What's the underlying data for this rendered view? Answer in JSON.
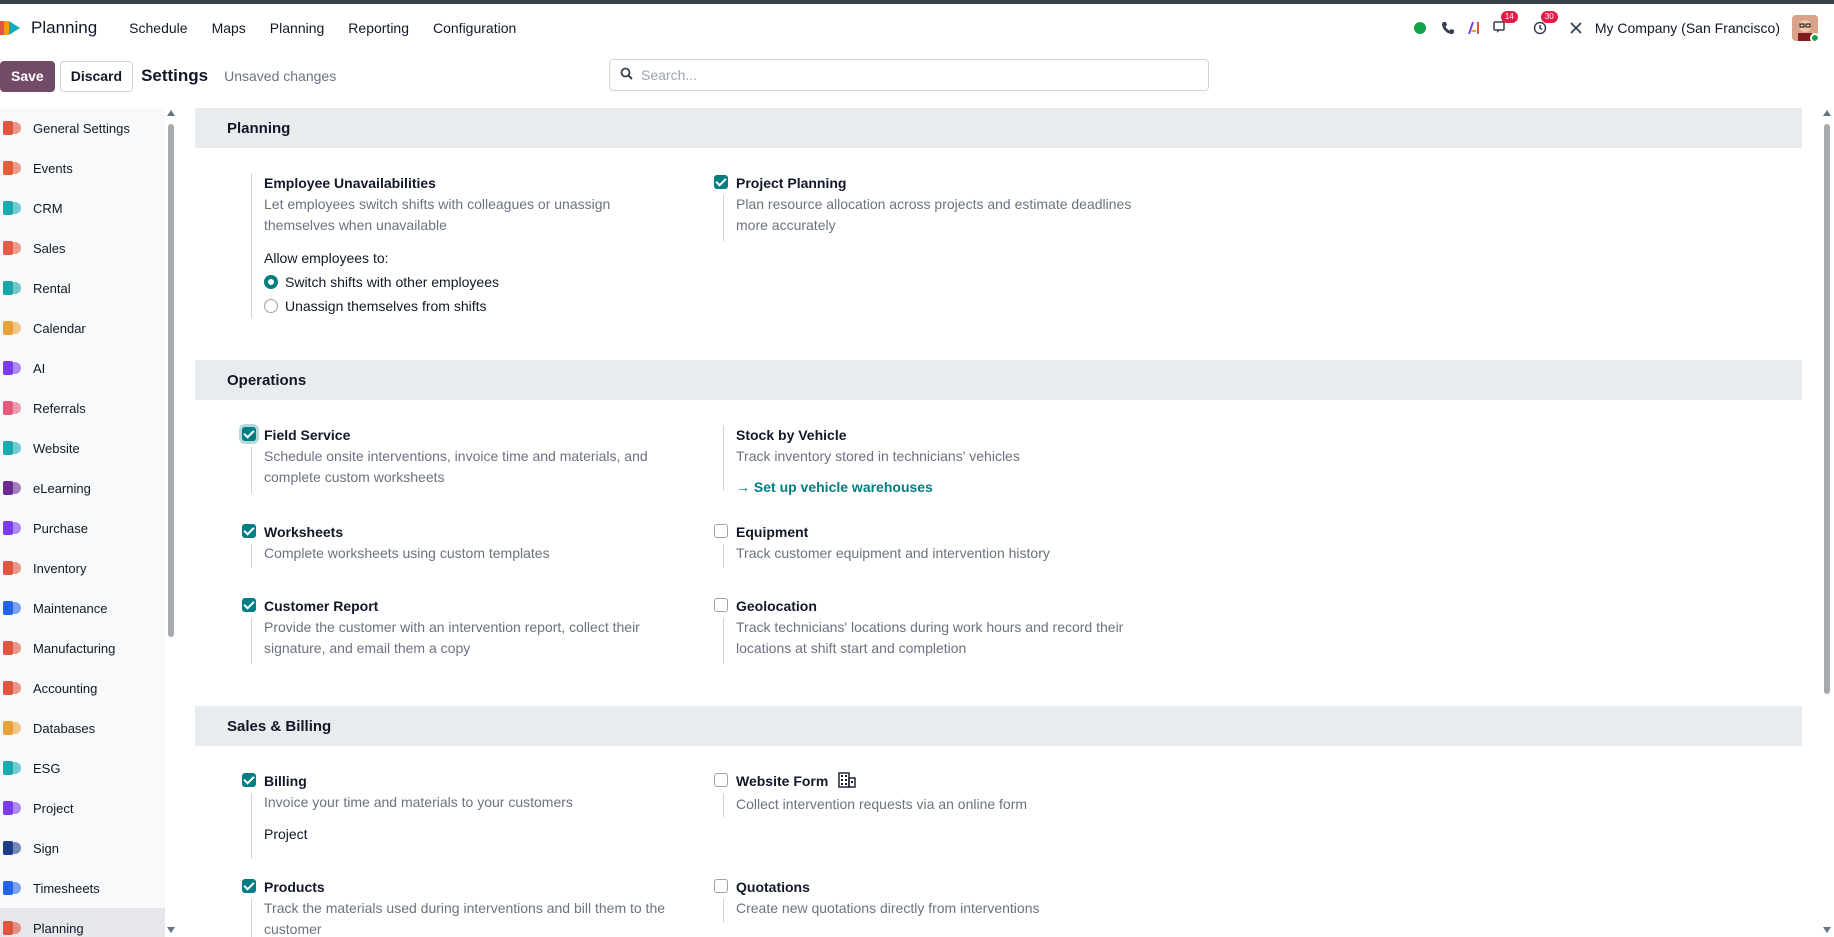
{
  "app": {
    "name": "Planning",
    "menu": [
      "Schedule",
      "Maps",
      "Planning",
      "Reporting",
      "Configuration"
    ],
    "company": "My Company (San Francisco)",
    "badges": {
      "discuss": "14",
      "activities": "30"
    }
  },
  "control": {
    "save_label": "Save",
    "discard_label": "Discard",
    "title": "Settings",
    "status": "Unsaved changes",
    "search_placeholder": "Search..."
  },
  "sidebar": {
    "items": [
      {
        "label": "General Settings",
        "icon": "general-settings-icon",
        "color": "#e0553f"
      },
      {
        "label": "Events",
        "icon": "events-icon",
        "color": "#e35d3a"
      },
      {
        "label": "CRM",
        "icon": "crm-icon",
        "color": "#19a9b0"
      },
      {
        "label": "Sales",
        "icon": "sales-icon",
        "color": "#e45b45"
      },
      {
        "label": "Rental",
        "icon": "rental-icon",
        "color": "#1aa5a8"
      },
      {
        "label": "Calendar",
        "icon": "calendar-icon",
        "color": "#e9a03b"
      },
      {
        "label": "AI",
        "icon": "ai-icon",
        "color": "#7c3aed"
      },
      {
        "label": "Referrals",
        "icon": "referrals-icon",
        "color": "#e45b7b"
      },
      {
        "label": "Website",
        "icon": "website-icon",
        "color": "#19a9b0"
      },
      {
        "label": "eLearning",
        "icon": "elearning-icon",
        "color": "#6b2c91"
      },
      {
        "label": "Purchase",
        "icon": "purchase-icon",
        "color": "#7c3aed"
      },
      {
        "label": "Inventory",
        "icon": "inventory-icon",
        "color": "#e0553f"
      },
      {
        "label": "Maintenance",
        "icon": "maintenance-icon",
        "color": "#2563eb"
      },
      {
        "label": "Manufacturing",
        "icon": "manufacturing-icon",
        "color": "#e0553f"
      },
      {
        "label": "Accounting",
        "icon": "accounting-icon",
        "color": "#e0553f"
      },
      {
        "label": "Databases",
        "icon": "databases-icon",
        "color": "#e9a03b"
      },
      {
        "label": "ESG",
        "icon": "esg-icon",
        "color": "#19a9b0"
      },
      {
        "label": "Project",
        "icon": "project-icon",
        "color": "#7c3aed"
      },
      {
        "label": "Sign",
        "icon": "sign-icon",
        "color": "#1e3a8a"
      },
      {
        "label": "Timesheets",
        "icon": "timesheets-icon",
        "color": "#2563eb"
      },
      {
        "label": "Planning",
        "icon": "planning-icon",
        "color": "#e0553f"
      }
    ]
  },
  "sections": {
    "planning": {
      "title": "Planning",
      "unavail_title": "Employee Unavailabilities",
      "unavail_desc": "Let employees switch shifts with colleagues or unassign themselves when unavailable",
      "allow_label": "Allow employees to:",
      "radio_switch": "Switch shifts with other employees",
      "radio_unassign": "Unassign themselves from shifts",
      "project_title": "Project Planning",
      "project_desc": "Plan resource allocation across projects and estimate deadlines more accurately"
    },
    "operations": {
      "title": "Operations",
      "field_service_title": "Field Service",
      "field_service_desc": "Schedule onsite interventions, invoice time and materials, and complete custom worksheets",
      "stock_title": "Stock by Vehicle",
      "stock_desc": "Track inventory stored in technicians' vehicles",
      "stock_link": "→ Set up vehicle warehouses",
      "worksheets_title": "Worksheets",
      "worksheets_desc": "Complete worksheets using custom templates",
      "equipment_title": "Equipment",
      "equipment_desc": "Track customer equipment and intervention history",
      "report_title": "Customer Report",
      "report_desc": "Provide the customer with an intervention report, collect their signature, and email them a copy",
      "geo_title": "Geolocation",
      "geo_desc": "Track technicians' locations during work hours and record their locations at shift start and completion"
    },
    "billing": {
      "title": "Sales & Billing",
      "billing_title": "Billing",
      "billing_desc": "Invoice your time and materials to your customers",
      "billing_sub": "Project",
      "webform_title": "Website Form",
      "webform_desc": "Collect intervention requests via an online form",
      "products_title": "Products",
      "products_desc": "Track the materials used during interventions and bill them to the customer",
      "quotations_title": "Quotations",
      "quotations_desc": "Create new quotations directly from interventions"
    }
  },
  "colors": {
    "accent": "#017e84",
    "primary": "#714b67"
  }
}
